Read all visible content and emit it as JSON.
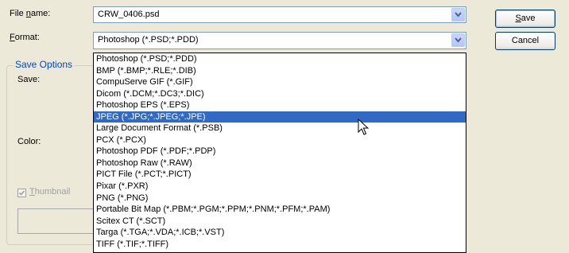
{
  "filename": {
    "label": "File name:",
    "value": "CRW_0406.psd"
  },
  "format": {
    "label": "Format:",
    "value": "Photoshop (*.PSD;*.PDD)",
    "options": [
      "Photoshop (*.PSD;*.PDD)",
      "BMP (*.BMP;*.RLE;*.DIB)",
      "CompuServe GIF (*.GIF)",
      "Dicom (*.DCM;*.DC3;*.DIC)",
      "Photoshop EPS (*.EPS)",
      "JPEG (*.JPG;*.JPEG;*.JPE)",
      "Large Document Format (*.PSB)",
      "PCX (*.PCX)",
      "Photoshop PDF (*.PDF;*.PDP)",
      "Photoshop Raw (*.RAW)",
      "PICT File (*.PCT;*.PICT)",
      "Pixar (*.PXR)",
      "PNG (*.PNG)",
      "Portable Bit Map (*.PBM;*.PGM;*.PPM;*.PNM;*.PFM;*.PAM)",
      "Scitex CT (*.SCT)",
      "Targa (*.TGA;*.VDA;*.ICB;*.VST)",
      "TIFF (*.TIF;*.TIFF)"
    ],
    "highlighted_index": 5
  },
  "buttons": {
    "save": "Save",
    "cancel": "Cancel"
  },
  "save_options": {
    "title": "Save Options",
    "save_label": "Save:",
    "color_label": "Color:",
    "thumbnail_label": "Thumbnail",
    "thumbnail_checked": true,
    "thumbnail_enabled": false
  },
  "icons": {
    "dropdown_arrow": "chevron-down-icon",
    "cursor": "mouse-pointer-icon"
  },
  "colors": {
    "selection": "#316ac5",
    "group_title": "#0046d5",
    "dialog_bg": "#ece9d8"
  }
}
